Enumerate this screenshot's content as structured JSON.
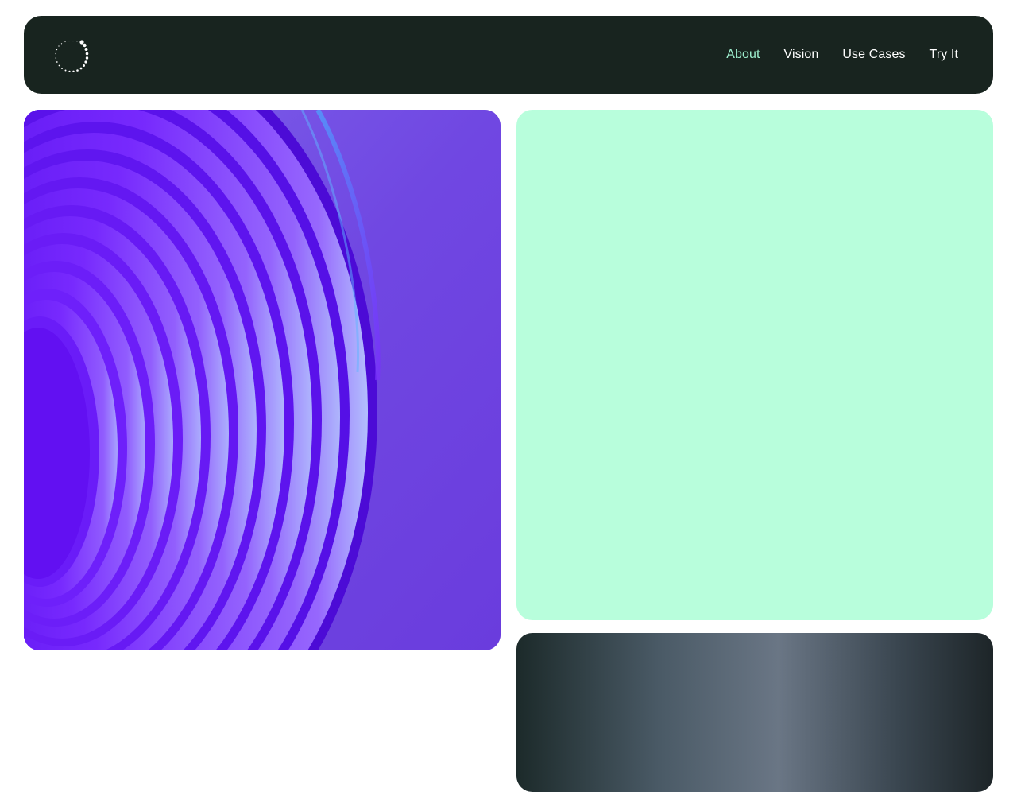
{
  "header": {
    "logo_icon": "dotted-circle-logo-icon",
    "nav": [
      {
        "label": "About",
        "active": true
      },
      {
        "label": "Vision",
        "active": false
      },
      {
        "label": "Use Cases",
        "active": false
      },
      {
        "label": "Try It",
        "active": false
      }
    ]
  },
  "colors": {
    "header_bg": "#18241f",
    "nav_active": "#9ef0cf",
    "mint_panel": "#b8fedc",
    "purple_panel": "#6f45e0"
  }
}
